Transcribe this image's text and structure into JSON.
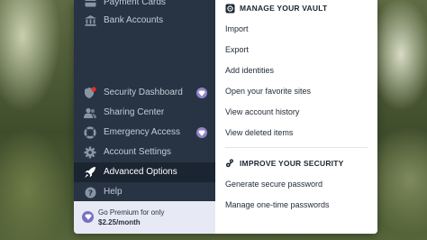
{
  "sidebar": {
    "items": [
      {
        "label": "Payment Cards",
        "icon": "card-icon",
        "active": false
      },
      {
        "label": "Bank Accounts",
        "icon": "bank-icon",
        "active": false
      },
      {
        "label": "Security Dashboard",
        "icon": "shield-icon",
        "active": false,
        "premium": true,
        "alert_dot": true
      },
      {
        "label": "Sharing Center",
        "icon": "people-icon",
        "active": false
      },
      {
        "label": "Emergency Access",
        "icon": "lifebuoy-icon",
        "active": false,
        "premium": true
      },
      {
        "label": "Account Settings",
        "icon": "gear-icon",
        "active": false
      },
      {
        "label": "Advanced Options",
        "icon": "rocket-icon",
        "active": true
      },
      {
        "label": "Help",
        "icon": "help-icon",
        "active": false
      }
    ],
    "premium_promo": {
      "line1": "Go Premium for only",
      "line2": "$2.25/month"
    }
  },
  "menu": {
    "vault": {
      "heading": "MANAGE YOUR VAULT",
      "items": [
        "Import",
        "Export",
        "Add identities",
        "Open your favorite sites",
        "View account history",
        "View deleted items"
      ]
    },
    "security": {
      "heading": "IMPROVE YOUR SECURITY",
      "items": [
        "Generate secure password",
        "Manage one-time passwords"
      ]
    }
  },
  "colors": {
    "sidebar_bg": "#283444",
    "sidebar_active_bg": "#1b2431",
    "premium_badge": "#8f84c9",
    "alert_dot": "#e0302b"
  }
}
